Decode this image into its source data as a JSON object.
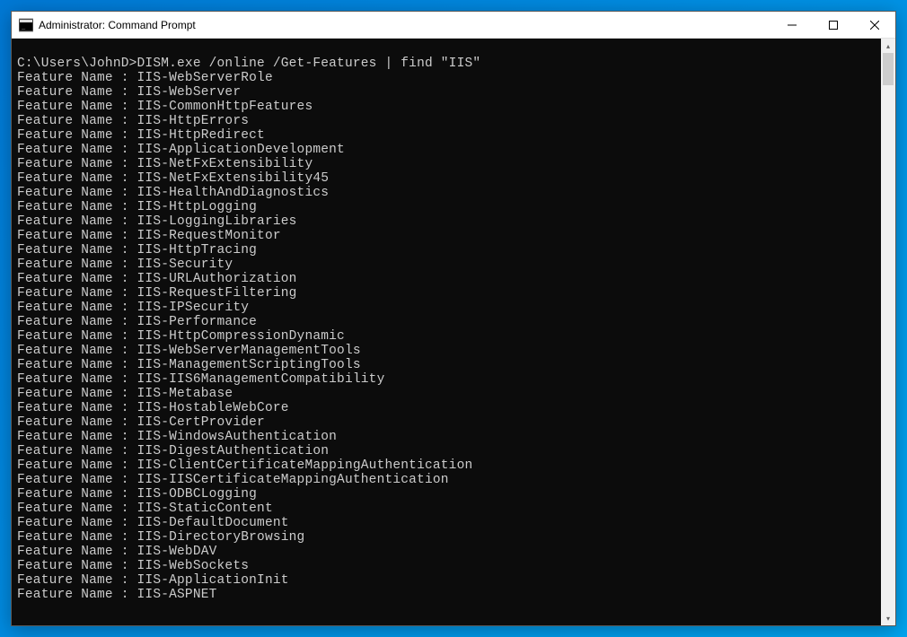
{
  "window": {
    "title": "Administrator: Command Prompt"
  },
  "terminal": {
    "prompt": "C:\\Users\\JohnD>",
    "command": "DISM.exe /online /Get-Features | find \"IIS\"",
    "feature_label": "Feature Name : ",
    "features": [
      "IIS-WebServerRole",
      "IIS-WebServer",
      "IIS-CommonHttpFeatures",
      "IIS-HttpErrors",
      "IIS-HttpRedirect",
      "IIS-ApplicationDevelopment",
      "IIS-NetFxExtensibility",
      "IIS-NetFxExtensibility45",
      "IIS-HealthAndDiagnostics",
      "IIS-HttpLogging",
      "IIS-LoggingLibraries",
      "IIS-RequestMonitor",
      "IIS-HttpTracing",
      "IIS-Security",
      "IIS-URLAuthorization",
      "IIS-RequestFiltering",
      "IIS-IPSecurity",
      "IIS-Performance",
      "IIS-HttpCompressionDynamic",
      "IIS-WebServerManagementTools",
      "IIS-ManagementScriptingTools",
      "IIS-IIS6ManagementCompatibility",
      "IIS-Metabase",
      "IIS-HostableWebCore",
      "IIS-CertProvider",
      "IIS-WindowsAuthentication",
      "IIS-DigestAuthentication",
      "IIS-ClientCertificateMappingAuthentication",
      "IIS-IISCertificateMappingAuthentication",
      "IIS-ODBCLogging",
      "IIS-StaticContent",
      "IIS-DefaultDocument",
      "IIS-DirectoryBrowsing",
      "IIS-WebDAV",
      "IIS-WebSockets",
      "IIS-ApplicationInit",
      "IIS-ASPNET"
    ]
  }
}
